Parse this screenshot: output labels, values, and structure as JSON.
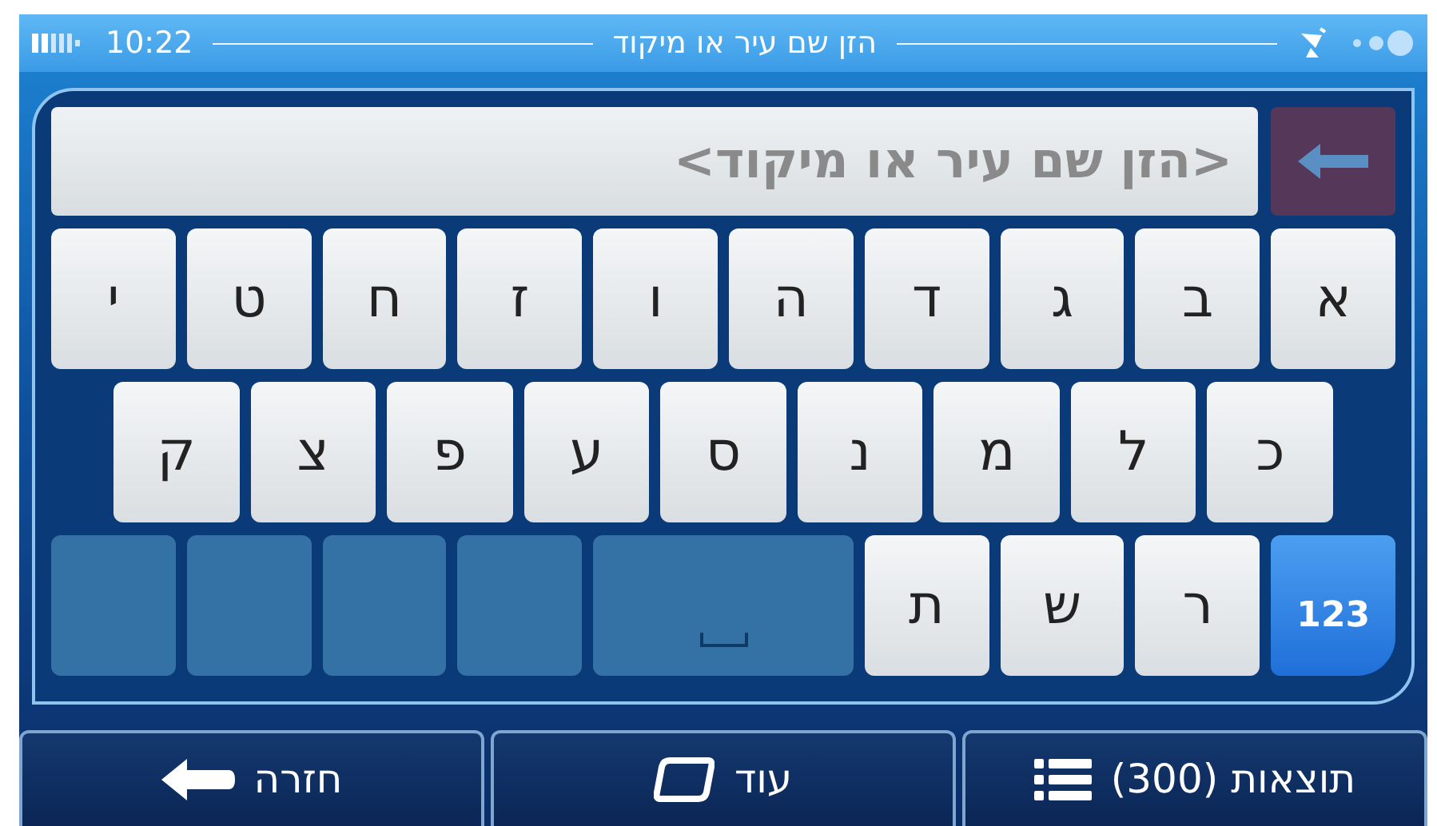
{
  "status_bar": {
    "time": "10:22",
    "title": "הזן שם עיר או מיקוד"
  },
  "search": {
    "placeholder": "<הזן שם עיר או מיקוד>"
  },
  "keyboard": {
    "rows": [
      [
        {
          "kind": "letter",
          "label": "א"
        },
        {
          "kind": "letter",
          "label": "ב"
        },
        {
          "kind": "letter",
          "label": "ג"
        },
        {
          "kind": "letter",
          "label": "ד"
        },
        {
          "kind": "letter",
          "label": "ה"
        },
        {
          "kind": "letter",
          "label": "ו"
        },
        {
          "kind": "letter",
          "label": "ז"
        },
        {
          "kind": "letter",
          "label": "ח"
        },
        {
          "kind": "letter",
          "label": "ט"
        },
        {
          "kind": "letter",
          "label": "י"
        }
      ],
      [
        {
          "kind": "letter",
          "label": "כ"
        },
        {
          "kind": "letter",
          "label": "ל"
        },
        {
          "kind": "letter",
          "label": "מ"
        },
        {
          "kind": "letter",
          "label": "נ"
        },
        {
          "kind": "letter",
          "label": "ס"
        },
        {
          "kind": "letter",
          "label": "ע"
        },
        {
          "kind": "letter",
          "label": "פ"
        },
        {
          "kind": "letter",
          "label": "צ"
        },
        {
          "kind": "letter",
          "label": "ק"
        }
      ],
      [
        {
          "kind": "mode",
          "label": "123"
        },
        {
          "kind": "letter",
          "label": "ר"
        },
        {
          "kind": "letter",
          "label": "ש"
        },
        {
          "kind": "letter",
          "label": "ת"
        },
        {
          "kind": "space",
          "disabled": true
        },
        {
          "kind": "blank",
          "disabled": true
        },
        {
          "kind": "blank",
          "disabled": true
        },
        {
          "kind": "blank",
          "disabled": true
        },
        {
          "kind": "blank",
          "disabled": true
        }
      ]
    ]
  },
  "bottom_bar": [
    {
      "kind": "results",
      "label": "תוצאות (300)"
    },
    {
      "kind": "more",
      "label": "עוד"
    },
    {
      "kind": "back",
      "label": "חזרה"
    }
  ]
}
